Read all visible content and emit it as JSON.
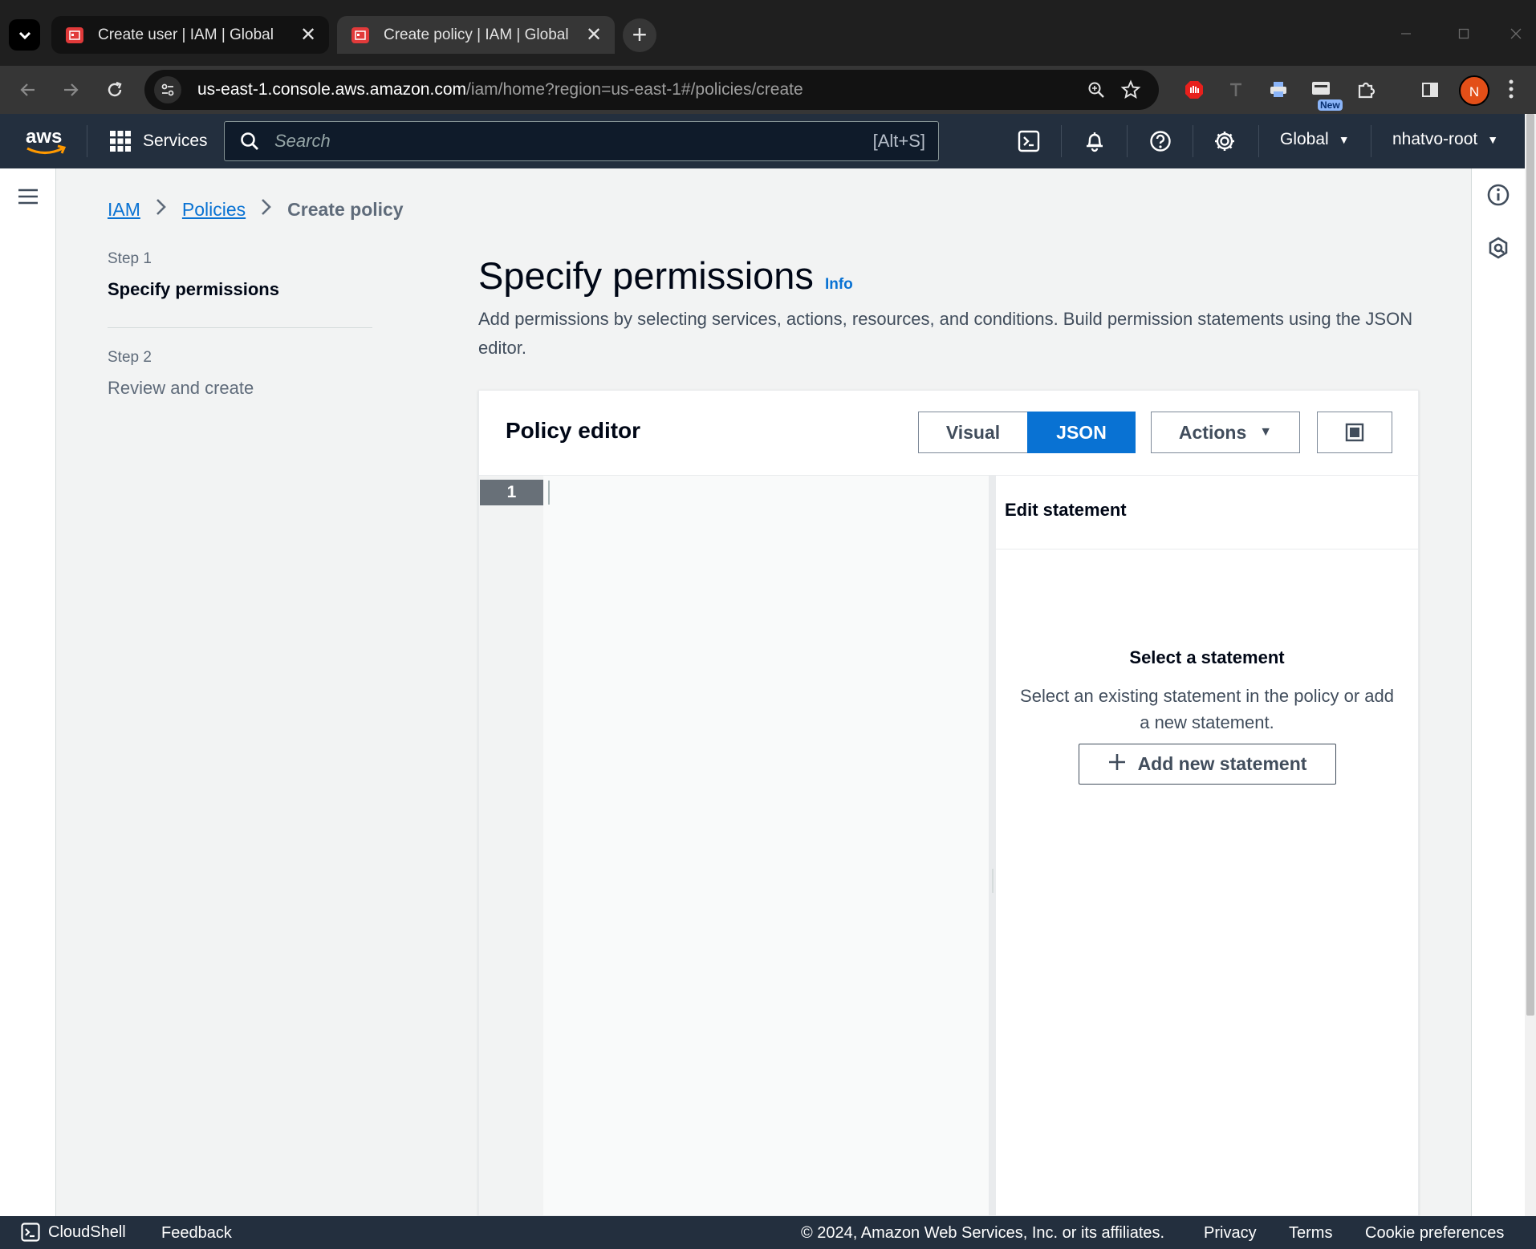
{
  "browser": {
    "tabs": [
      {
        "title": "Create user | IAM | Global",
        "active": false
      },
      {
        "title": "Create policy | IAM | Global",
        "active": true
      }
    ],
    "url_host": "us-east-1.console.aws.amazon.com",
    "url_path": "/iam/home?region=us-east-1#/policies/create",
    "new_badge": "New",
    "profile_initial": "N",
    "new_tab_glyph": "+",
    "close_glyph": "✕"
  },
  "aws_nav": {
    "services_label": "Services",
    "search_placeholder": "Search",
    "search_shortcut": "[Alt+S]",
    "region_label": "Global",
    "account_label": "nhatvo-root",
    "accent_color": "#ff9900"
  },
  "breadcrumb": {
    "items": [
      "IAM",
      "Policies"
    ],
    "current": "Create policy"
  },
  "wizard": {
    "steps": [
      {
        "label": "Step 1",
        "title": "Specify permissions",
        "current": true
      },
      {
        "label": "Step 2",
        "title": "Review and create",
        "current": false
      }
    ]
  },
  "main": {
    "title": "Specify permissions",
    "info_link": "Info",
    "description": "Add permissions by selecting services, actions, resources, and conditions. Build permission statements using the JSON editor."
  },
  "policy_editor": {
    "title": "Policy editor",
    "modes": [
      "Visual",
      "JSON"
    ],
    "selected_mode": "JSON",
    "actions_label": "Actions",
    "line_numbers": [
      "1"
    ],
    "code": "",
    "edit_panel": {
      "title": "Edit statement",
      "empty_title": "Select a statement",
      "empty_desc": "Select an existing statement in the policy or add a new statement.",
      "add_button": "Add new statement"
    },
    "primary_color": "#0972d3"
  },
  "footer": {
    "cloudshell": "CloudShell",
    "feedback": "Feedback",
    "copyright": "© 2024, Amazon Web Services, Inc. or its affiliates.",
    "privacy": "Privacy",
    "terms": "Terms",
    "cookies": "Cookie preferences"
  }
}
